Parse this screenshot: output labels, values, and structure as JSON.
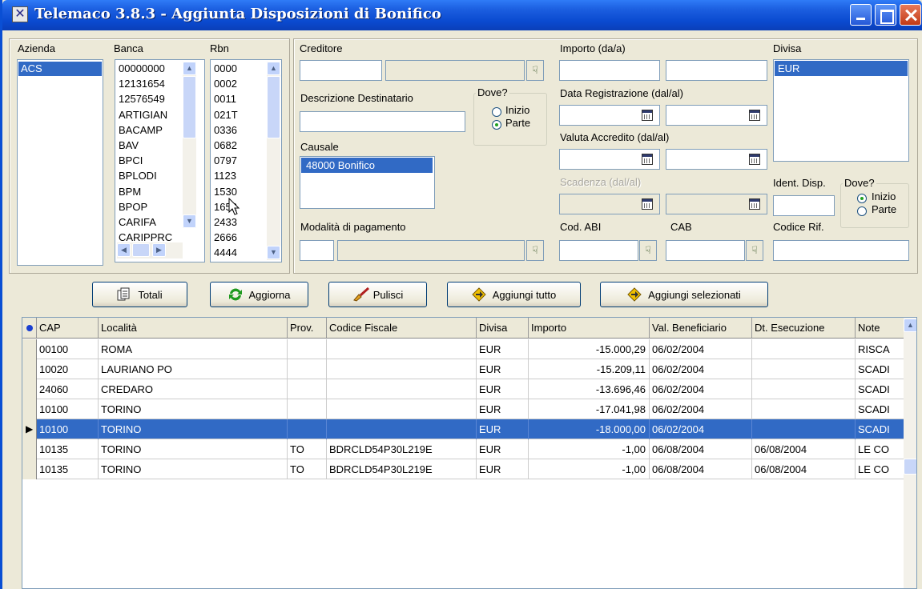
{
  "window": {
    "title": "Telemaco 3.8.3  - Aggiunta Disposizioni di Bonifico",
    "app_icon": "telemaco-app-icon"
  },
  "filters": {
    "azienda": {
      "label": "Azienda",
      "items": [
        "ACS"
      ],
      "selected": "ACS"
    },
    "banca": {
      "label": "Banca",
      "items": [
        "00000000",
        "12131654",
        "12576549",
        "ARTIGIAN",
        "BACAMP",
        "BAV",
        "BPCI",
        "BPLODI",
        "BPM",
        "BPOP",
        "CARIFA",
        "CARIPPRC"
      ]
    },
    "rbn": {
      "label": "Rbn",
      "items": [
        "0000",
        "0002",
        "0011",
        "021T",
        "0336",
        "0682",
        "0797",
        "1123",
        "1530",
        "1652",
        "2433",
        "2666",
        "4444"
      ]
    },
    "creditore": {
      "label": "Creditore",
      "value_code": "",
      "value_name": ""
    },
    "descrizione_destinatario": {
      "label": "Descrizione Destinatario",
      "value": ""
    },
    "dove_1": {
      "label": "Dove?",
      "options": [
        "Inizio",
        "Parte"
      ],
      "selected": "Parte"
    },
    "causale": {
      "label": "Causale",
      "items": [
        "48000  Bonifico"
      ],
      "selected": "48000  Bonifico"
    },
    "modalita_pagamento": {
      "label": "Modalità di pagamento",
      "value_code": "",
      "value_name": ""
    },
    "importo": {
      "label": "Importo (da/a)",
      "from": "",
      "to": ""
    },
    "data_registrazione": {
      "label": "Data Registrazione (dal/al)",
      "from": "",
      "to": ""
    },
    "valuta_accredito": {
      "label": "Valuta Accredito (dal/al)",
      "from": "",
      "to": ""
    },
    "scadenza": {
      "label": "Scadenza (dal/al)",
      "from": "",
      "to": ""
    },
    "cod_abi": {
      "label": "Cod. ABI",
      "value": ""
    },
    "cab": {
      "label": "CAB",
      "value": ""
    },
    "divisa": {
      "label": "Divisa",
      "items": [
        "EUR"
      ],
      "selected": "EUR"
    },
    "ident_disp": {
      "label": "Ident. Disp.",
      "value": ""
    },
    "dove_2": {
      "label": "Dove?",
      "options": [
        "Inizio",
        "Parte"
      ],
      "selected": "Inizio"
    },
    "codice_rif": {
      "label": "Codice Rif.",
      "value": ""
    }
  },
  "toolbar": {
    "totali": "Totali",
    "aggiorna": "Aggiorna",
    "pulisci": "Pulisci",
    "aggiungi_tutto": "Aggiungi tutto",
    "aggiungi_selezionati": "Aggiungi selezionati"
  },
  "grid": {
    "columns": [
      "CAP",
      "Località",
      "Prov.",
      "Codice Fiscale",
      "Divisa",
      "Importo",
      "Val. Beneficiario",
      "Dt. Esecuzione",
      "Note"
    ],
    "rows": [
      {
        "cap": "00100",
        "localita": "ROMA",
        "prov": "",
        "cf": "",
        "divisa": "EUR",
        "importo": "-15.000,29",
        "val_ben": "06/02/2004",
        "dt_exec": "",
        "note": "RISCA"
      },
      {
        "cap": "10020",
        "localita": "LAURIANO PO",
        "prov": "",
        "cf": "",
        "divisa": "EUR",
        "importo": "-15.209,11",
        "val_ben": "06/02/2004",
        "dt_exec": "",
        "note": "SCADI"
      },
      {
        "cap": "24060",
        "localita": "CREDARO",
        "prov": "",
        "cf": "",
        "divisa": "EUR",
        "importo": "-13.696,46",
        "val_ben": "06/02/2004",
        "dt_exec": "",
        "note": "SCADI"
      },
      {
        "cap": "10100",
        "localita": "TORINO",
        "prov": "",
        "cf": "",
        "divisa": "EUR",
        "importo": "-17.041,98",
        "val_ben": "06/02/2004",
        "dt_exec": "",
        "note": "SCADI"
      },
      {
        "cap": "10100",
        "localita": "TORINO",
        "prov": "",
        "cf": "",
        "divisa": "EUR",
        "importo": "-18.000,00",
        "val_ben": "06/02/2004",
        "dt_exec": "",
        "note": "SCADI",
        "selected": true
      },
      {
        "cap": "10135",
        "localita": "TORINO",
        "prov": "TO",
        "cf": "BDRCLD54P30L219E",
        "divisa": "EUR",
        "importo": "-1,00",
        "val_ben": "06/08/2004",
        "dt_exec": "06/08/2004",
        "note": "LE CO"
      },
      {
        "cap": "10135",
        "localita": "TORINO",
        "prov": "TO",
        "cf": "BDRCLD54P30L219E",
        "divisa": "EUR",
        "importo": "-1,00",
        "val_ben": "06/08/2004",
        "dt_exec": "06/08/2004",
        "note": "LE CO"
      }
    ]
  },
  "colors": {
    "titlebar": "#0a4ad0",
    "selection": "#316ac5",
    "face": "#ece9d8"
  }
}
